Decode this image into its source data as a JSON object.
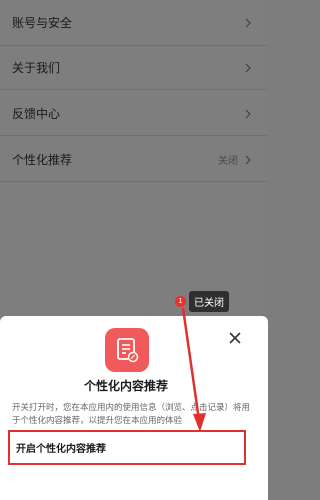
{
  "settings": {
    "items": [
      {
        "label": "账号与安全",
        "value": ""
      },
      {
        "label": "关于我们",
        "value": ""
      },
      {
        "label": "反馈中心",
        "value": ""
      },
      {
        "label": "个性化推荐",
        "value": "关闭"
      }
    ]
  },
  "toast": {
    "badge": "1",
    "text": "已关闭"
  },
  "sheet": {
    "title": "个性化内容推荐",
    "description": "开关打开时，您在本应用内的使用信息（浏览、点击记录）将用于个性化内容推荐，以提升您在本应用的体验",
    "enable_label": "开启个性化内容推荐"
  },
  "colors": {
    "accent_red": "#e0312c",
    "icon_bg": "#f05a5a",
    "overlay_gray": "#7e7e7e"
  },
  "icons": {
    "chevron": "chevron-right-icon",
    "close": "close-icon",
    "document": "document-edit-icon"
  }
}
